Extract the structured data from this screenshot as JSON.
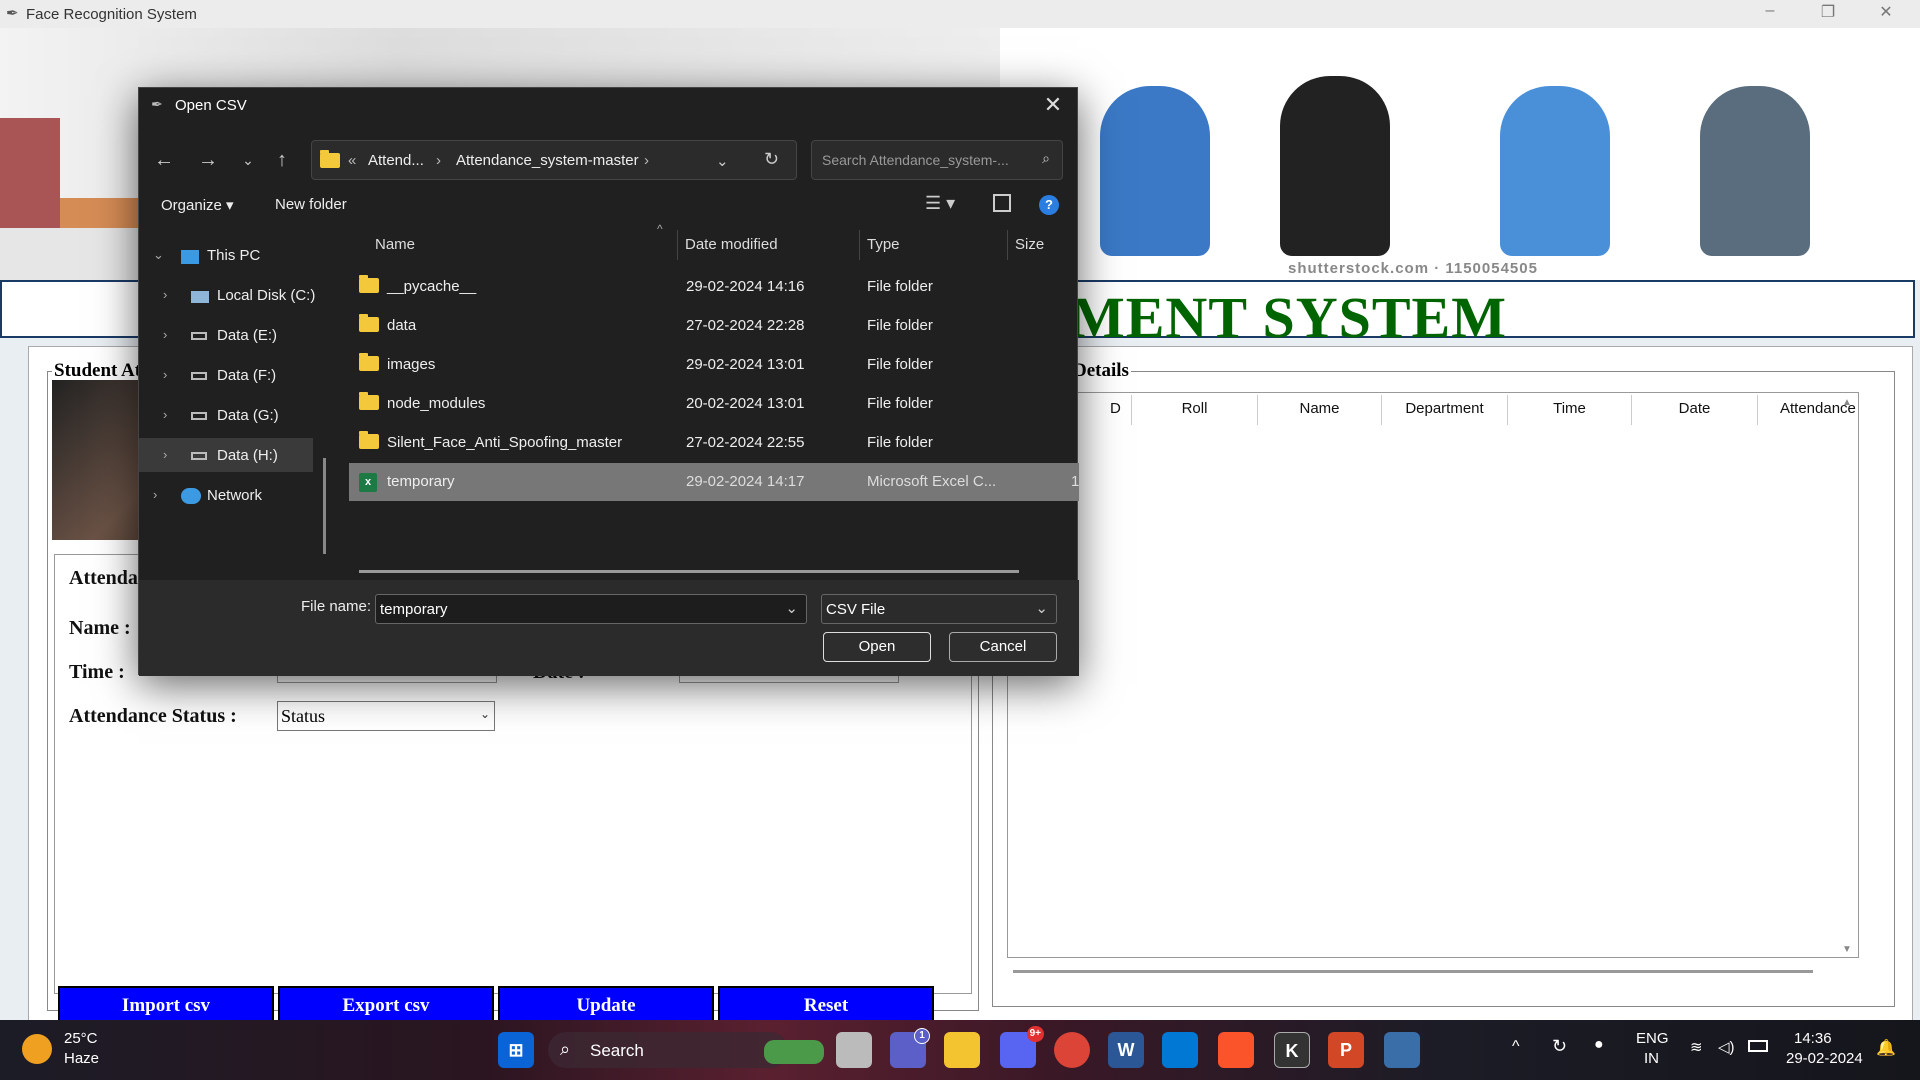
{
  "app": {
    "title": "Face Recognition System",
    "min": "–",
    "max": "❐",
    "close": "✕"
  },
  "banner": {
    "watermark": "shutterstock.com · 1150054505",
    "system_title": "MENT SYSTEM"
  },
  "left_frame": {
    "legend": "Student At",
    "labels": {
      "attendance": "Attenda",
      "name": "Name :",
      "time": "Time :",
      "date": "Date :",
      "status": "Attendance Status :"
    },
    "status_select": "Status",
    "buttons": [
      "Import csv",
      "Export csv",
      "Update",
      "Reset"
    ]
  },
  "right_frame": {
    "legend": "Details",
    "columns": [
      "D",
      "Roll",
      "Name",
      "Department",
      "Time",
      "Date",
      "Attendance"
    ]
  },
  "dialog": {
    "title": "Open CSV",
    "path": {
      "prefix": "«",
      "seg1": "Attend...",
      "sep": "›",
      "seg2": "Attendance_system-master",
      "sep2": "›"
    },
    "search_placeholder": "Search Attendance_system-...",
    "toolbar": {
      "organize": "Organize ▾",
      "new_folder": "New folder"
    },
    "tree": [
      {
        "label": "This PC",
        "chev": "⌄"
      },
      {
        "label": "Local Disk (C:)",
        "chev": "›"
      },
      {
        "label": "Data (E:)",
        "chev": "›"
      },
      {
        "label": "Data (F:)",
        "chev": "›"
      },
      {
        "label": "Data (G:)",
        "chev": "›"
      },
      {
        "label": "Data (H:)",
        "chev": "›"
      },
      {
        "label": "Network",
        "chev": "›"
      }
    ],
    "columns": {
      "name": "Name",
      "date": "Date modified",
      "type": "Type",
      "size": "Size"
    },
    "files": [
      {
        "name": "__pycache__",
        "date": "29-02-2024 14:16",
        "type": "File folder",
        "size": ""
      },
      {
        "name": "data",
        "date": "27-02-2024 22:28",
        "type": "File folder",
        "size": ""
      },
      {
        "name": "images",
        "date": "29-02-2024 13:01",
        "type": "File folder",
        "size": ""
      },
      {
        "name": "node_modules",
        "date": "20-02-2024 13:01",
        "type": "File folder",
        "size": ""
      },
      {
        "name": "Silent_Face_Anti_Spoofing_master",
        "date": "27-02-2024 22:55",
        "type": "File folder",
        "size": ""
      },
      {
        "name": "temporary",
        "date": "29-02-2024 14:17",
        "type": "Microsoft Excel C...",
        "size": "1"
      }
    ],
    "file_name_label": "File name:",
    "file_name_value": "temporary",
    "file_type": "CSV File",
    "open": "Open",
    "cancel": "Cancel"
  },
  "taskbar": {
    "weather_temp": "25°C",
    "weather_desc": "Haze",
    "search": "Search",
    "teams_badge": "1",
    "discord_badge": "9+",
    "lang1": "ENG",
    "lang2": "IN",
    "time": "14:36",
    "date": "29-02-2024"
  }
}
